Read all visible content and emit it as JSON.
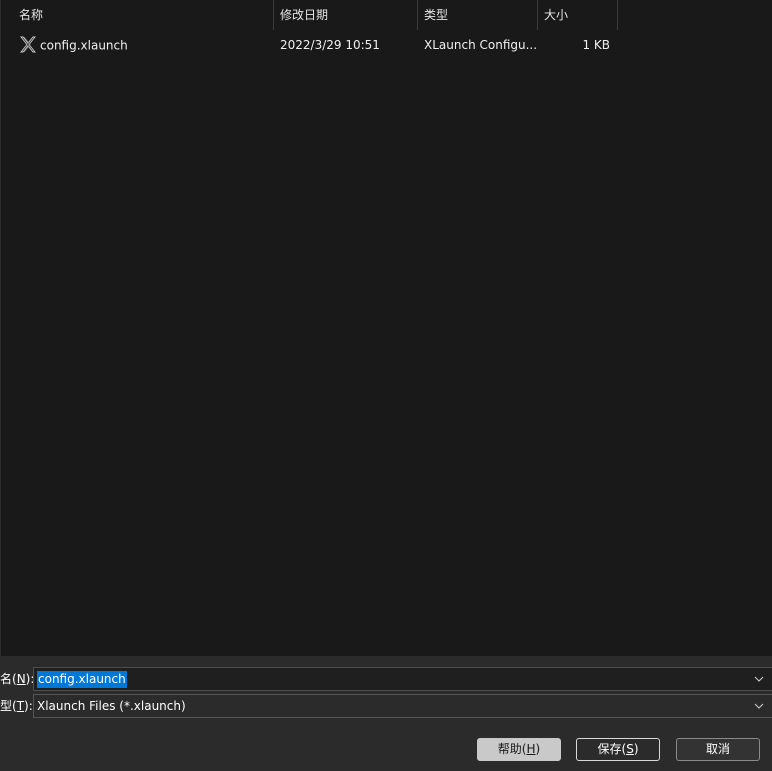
{
  "columns": {
    "name": "名称",
    "date_modified": "修改日期",
    "type": "类型",
    "size": "大小"
  },
  "files": [
    {
      "name": "config.xlaunch",
      "date_modified": "2022/3/29 10:51",
      "type": "XLaunch Configu...",
      "size": "1 KB",
      "icon": "xlaunch-file-icon"
    }
  ],
  "bottom": {
    "filename_label": "名(",
    "filename_mnemonic": "N",
    "filename_label_end": "):",
    "filename_value": "config.xlaunch",
    "filetype_label": "型(",
    "filetype_mnemonic": "T",
    "filetype_label_end": "):",
    "filetype_value": "Xlaunch Files (*.xlaunch)",
    "help_label": "帮助(",
    "help_mnemonic": "H",
    "help_label_end": ")",
    "save_label": "保存(",
    "save_mnemonic": "S",
    "save_label_end": ")",
    "cancel_label": "取消"
  },
  "colors": {
    "background": "#191919",
    "panel": "#2b2b2b",
    "selection": "#0078d7"
  }
}
